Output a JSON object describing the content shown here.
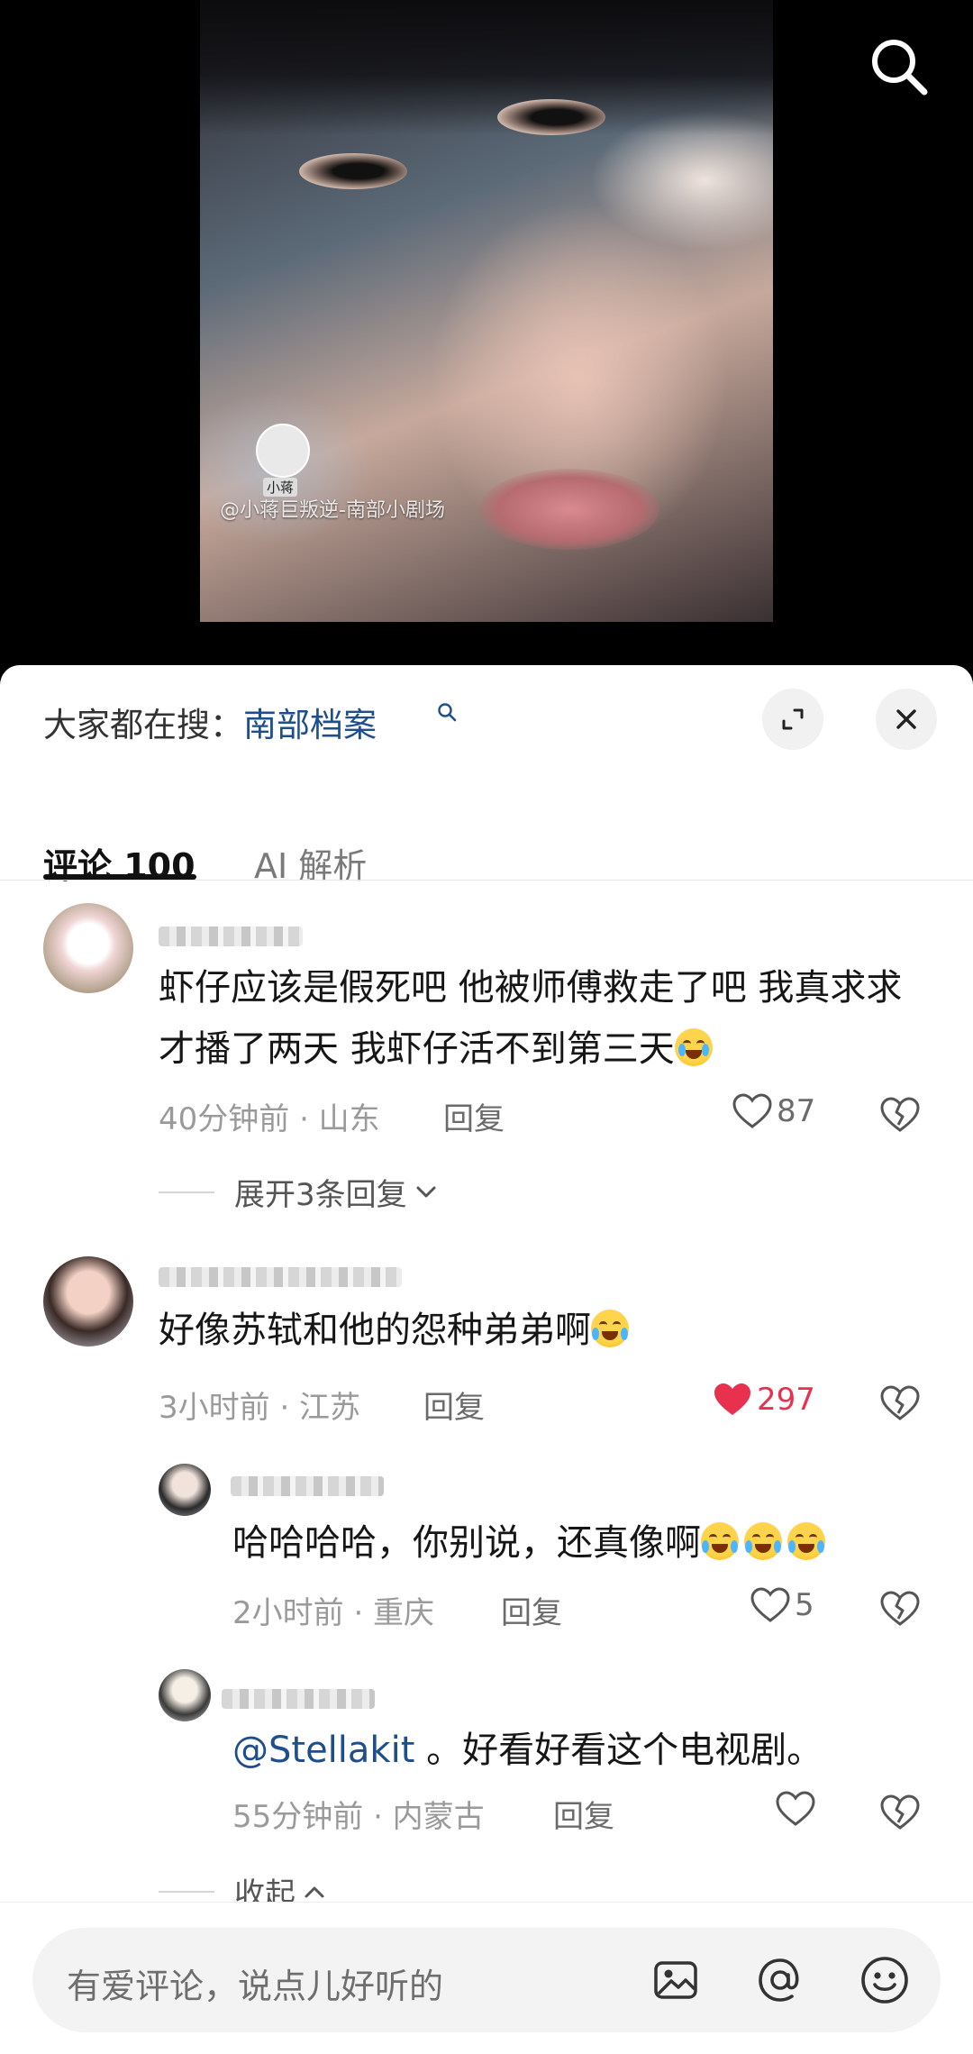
{
  "video": {
    "watermark": "@小蒋巨叛逆-南部小剧场",
    "watermark_name": "小蒋"
  },
  "sheet": {
    "trending_label": "大家都在搜：",
    "trending_term": "南部档案",
    "tabs": [
      {
        "label": "评论 100",
        "active": true
      },
      {
        "label": "AI 解析",
        "active": false
      }
    ]
  },
  "comments": [
    {
      "text": "虾仔应该是假死吧 他被师傅救走了吧 我真求求 才播了两天 我虾仔活不到第三天",
      "emoji": "loudly-crying-face",
      "time": "40分钟前 · 山东",
      "reply_label": "回复",
      "likes": "87",
      "liked": false,
      "expand_label": "展开3条回复"
    },
    {
      "text": "好像苏轼和他的怨种弟弟啊",
      "emoji": "tears-of-joy-face",
      "time": "3小时前 · 江苏",
      "reply_label": "回复",
      "likes": "297",
      "liked": true,
      "replies": [
        {
          "text": "哈哈哈哈，你别说，还真像啊",
          "emoji": "rolling-laughing-face x3",
          "time": "2小时前 · 重庆",
          "reply_label": "回复",
          "likes": "5"
        },
        {
          "mention": "@Stellakit",
          "text": " 。好看好看这个电视剧。",
          "time": "55分钟前 · 内蒙古",
          "reply_label": "回复",
          "likes": ""
        }
      ],
      "collapse_label": "收起"
    }
  ],
  "input": {
    "placeholder": "有爱评论，说点儿好听的"
  },
  "icons": {
    "search": "search-icon",
    "expand": "expand-icon",
    "close": "close-icon",
    "heart": "heart-icon",
    "broken_heart": "dislike-icon",
    "image": "image-icon",
    "mention": "at-icon",
    "emoji": "emoji-icon"
  },
  "colors": {
    "like_active": "#e8304f",
    "link": "#1e4e8c",
    "muted": "#9a9a9a"
  }
}
